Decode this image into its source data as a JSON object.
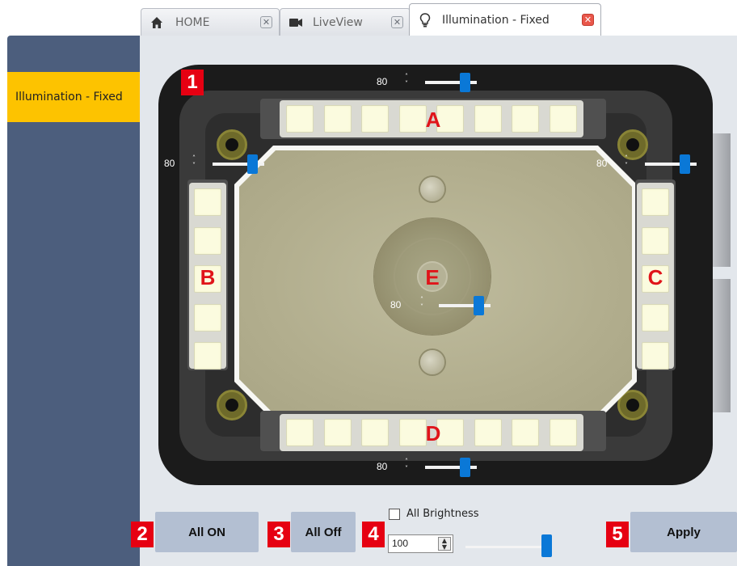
{
  "tabs": [
    {
      "label": "HOME",
      "icon": "home-icon",
      "close": "✕"
    },
    {
      "label": "LiveView",
      "icon": "video-camera-icon",
      "close": "✕"
    },
    {
      "label": "Illumination - Fixed",
      "icon": "lightbulb-icon",
      "close": "✕",
      "active": true
    }
  ],
  "sidebar": {
    "items": [
      {
        "label": "Illumination - Fixed",
        "selected": true
      }
    ]
  },
  "zones": {
    "A": {
      "letter": "A",
      "value": "80",
      "level": 0.8
    },
    "B": {
      "letter": "B",
      "value": "80",
      "level": 0.8
    },
    "C": {
      "letter": "C",
      "value": "80",
      "level": 0.8
    },
    "D": {
      "letter": "D",
      "value": "80",
      "level": 0.8
    },
    "E": {
      "letter": "E",
      "value": "80",
      "level": 0.8
    }
  },
  "markers": [
    "1",
    "2",
    "3",
    "4",
    "5"
  ],
  "controls": {
    "all_on_label": "All ON",
    "all_off_label": "All Off",
    "all_brightness_label": "All Brightness",
    "all_brightness_checked": false,
    "all_brightness_value": "100",
    "all_brightness_level": 1.0,
    "apply_label": "Apply"
  },
  "colors": {
    "accent": "#0a78d7",
    "sidebar": "#4c5e7d",
    "selected": "#fdc300",
    "marker": "#e60012",
    "zone_letter": "#e0141a"
  }
}
